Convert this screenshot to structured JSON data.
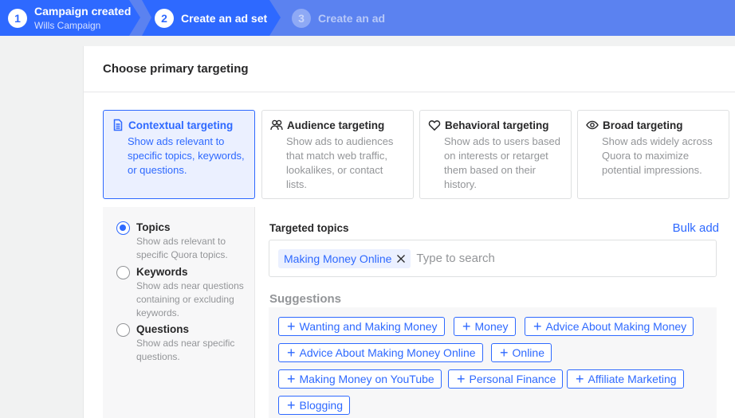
{
  "stepper": {
    "steps": [
      {
        "num": "1",
        "title": "Campaign created",
        "subtitle": "Wills Campaign"
      },
      {
        "num": "2",
        "title": "Create an ad set"
      },
      {
        "num": "3",
        "title": "Create an ad"
      }
    ]
  },
  "panel": {
    "title": "Choose primary targeting",
    "cards": [
      {
        "title": "Contextual targeting",
        "icon": "document-icon",
        "desc": "Show ads relevant to specific topics, keywords, or questions."
      },
      {
        "title": "Audience targeting",
        "icon": "users-icon",
        "desc": "Show ads to audiences that match web traffic, lookalikes, or contact lists."
      },
      {
        "title": "Behavioral targeting",
        "icon": "heart-icon",
        "desc": "Show ads to users based on interests or retarget them based on their history."
      },
      {
        "title": "Broad targeting",
        "icon": "eye-icon",
        "desc": "Show ads widely across Quora to maximize potential impressions."
      }
    ]
  },
  "options": [
    {
      "label": "Topics",
      "desc": "Show ads relevant to specific Quora topics.",
      "checked": true
    },
    {
      "label": "Keywords",
      "desc": "Show ads near questions containing or excluding keywords.",
      "checked": false
    },
    {
      "label": "Questions",
      "desc": "Show ads near specific questions.",
      "checked": false
    }
  ],
  "topics": {
    "title": "Targeted topics",
    "bulk_add": "Bulk add",
    "selected": [
      "Making Money Online"
    ],
    "placeholder": "Type to search",
    "suggestions_title": "Suggestions",
    "suggestions": [
      "Wanting and Making Money",
      "Money",
      "Advice About Making Money",
      "Advice About Making Money Online",
      "Online",
      "Making Money on YouTube",
      "Personal Finance",
      "Affiliate Marketing",
      "Blogging"
    ]
  },
  "colors": {
    "accent": "#2e69ff",
    "stepper_bg": "#5b82f0",
    "muted_text": "#939598"
  }
}
